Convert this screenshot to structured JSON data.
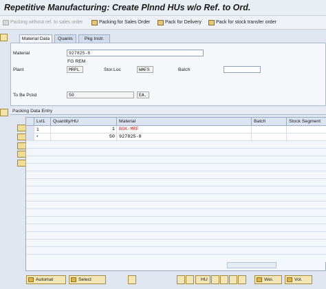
{
  "title": "Repetitive Manufacturing: Create Plnnd HUs w/o Ref. to Ord.",
  "toolbar": {
    "packing_without_ref": "Packing without ref. to sales order",
    "packing_for_sales_order": "Packing for Sales Order",
    "pack_for_delivery": "Pack for Delivery",
    "pack_for_stock_transfer": "Pack for stock transfer order"
  },
  "tabs": [
    "Material Data",
    "Quants",
    "Pkg Instr."
  ],
  "form": {
    "material_label": "Material",
    "material_value": "927825-8",
    "material_desc": "FG REM",
    "plant_label": "Plant",
    "plant_value": "MRPL",
    "stor_loc_label": "Stor.Loc",
    "stor_loc_value": "WAFS",
    "batch_label": "Batch",
    "batch_value": "",
    "to_be_pckd_label": "To Be Pckd",
    "to_be_pckd_value": "50",
    "uom_value": "EA."
  },
  "section_title": "Packing Data Entry",
  "grid": {
    "columns": [
      "Lvl1",
      "Quantity/HU",
      "Material",
      "Batch",
      "Stock Segment"
    ],
    "rows": [
      {
        "lvl": "1",
        "qty": "1",
        "material": "BOX-MRF",
        "batch": "",
        "stock": ""
      },
      {
        "lvl": "*",
        "qty": "50",
        "material": "927825-8",
        "batch": "",
        "stock": ""
      }
    ]
  },
  "footer": {
    "automat": "Automat",
    "select": "Select",
    "hu": "HU",
    "wei": "Wei.",
    "vol": "Vol."
  }
}
